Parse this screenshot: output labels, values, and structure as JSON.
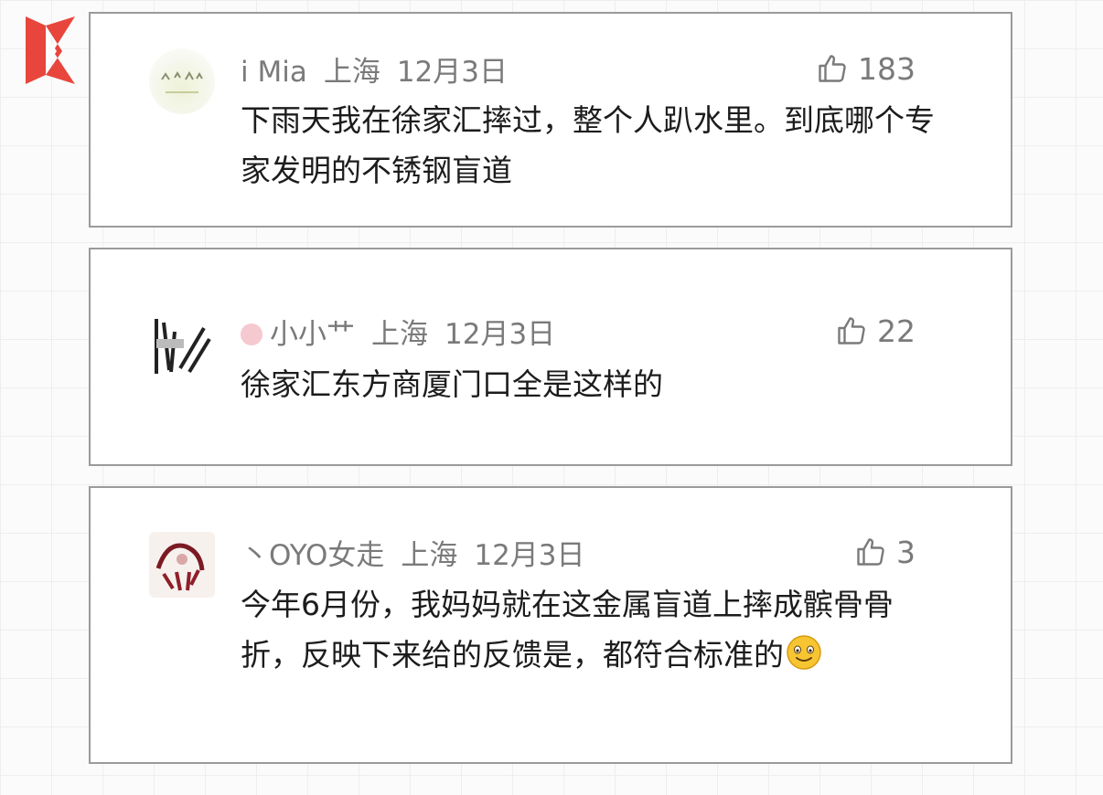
{
  "comments": [
    {
      "user": "i Mia",
      "location": "上海",
      "date": "12月3日",
      "likes": "183",
      "text": "下雨天我在徐家汇摔过，整个人趴水里。到底哪个专家发明的不锈钢盲道"
    },
    {
      "user": "小小艹",
      "location": "上海",
      "date": "12月3日",
      "likes": "22",
      "text": "徐家汇东方商厦门口全是这样的"
    },
    {
      "user": "丶OYO女走",
      "location": "上海",
      "date": "12月3日",
      "likes": "3",
      "text": "今年6月份，我妈妈就在这金属盲道上摔成髌骨骨折，反映下来给的反馈是，都符合标准的"
    }
  ],
  "colors": {
    "brand": "#e8453c",
    "meta_gray": "#7a7a7a",
    "card_border": "#9a9a9a"
  },
  "icons": [
    "logo-k",
    "thumbs-up-icon",
    "smile-emoji"
  ]
}
